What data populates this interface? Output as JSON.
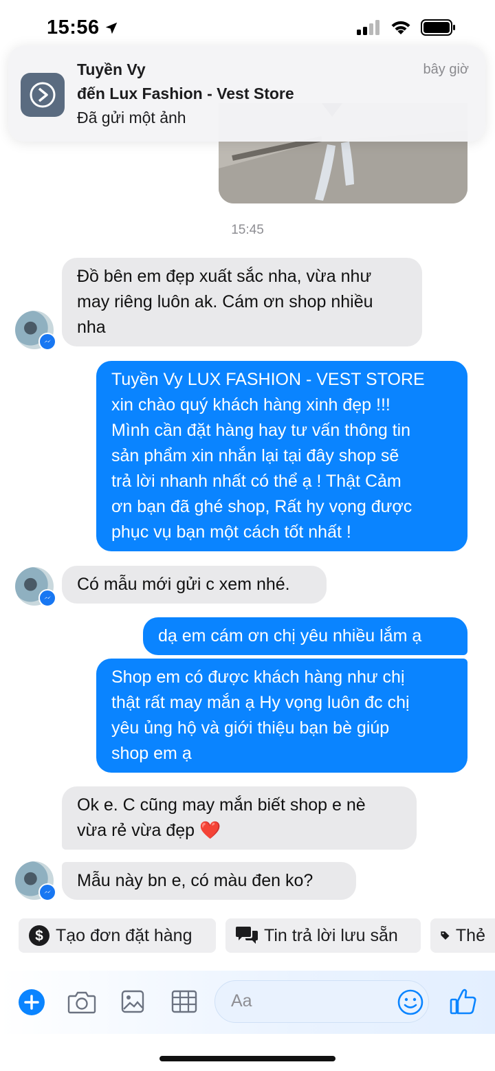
{
  "status": {
    "time": "15:56"
  },
  "notification": {
    "sender": "Tuyền Vy",
    "to": "đến Lux Fashion - Vest Store",
    "message": "Đã gửi một ảnh",
    "time": "bây giờ"
  },
  "chat": {
    "timestamp": "15:45",
    "messages": [
      {
        "from": "customer",
        "text": "Đồ bên em đẹp xuất sắc nha, vừa như\nmay riêng luôn ak. Cám ơn shop nhiều\nnha"
      },
      {
        "from": "shop",
        "text": "Tuyền Vy LUX FASHION - VEST STORE\nxin chào quý khách hàng xinh đẹp !!!\nMình cần đặt hàng hay tư vấn thông tin\nsản phẩm xin nhắn lại tại đây shop sẽ\ntrả lời nhanh nhất có thể ạ ! Thật Cảm\nơn bạn đã ghé shop, Rất hy vọng được\nphục vụ bạn một cách tốt nhất !"
      },
      {
        "from": "customer",
        "text": "Có mẫu mới gửi c xem nhé."
      },
      {
        "from": "shop",
        "text": "dạ em cám ơn chị yêu nhiều lắm ạ"
      },
      {
        "from": "shop",
        "text": "Shop em có được khách hàng như chị\nthật rất may mắn ạ Hy vọng luôn đc chị\nyêu ủng hộ và giới thiệu bạn bè giúp\nshop em ạ"
      },
      {
        "from": "customer",
        "text": "Ok e. C cũng may mắn biết shop e nè\nvừa rẻ vừa đẹp ❤️"
      },
      {
        "from": "customer",
        "text": "Mẫu này bn e, có màu đen ko?"
      }
    ]
  },
  "quick_replies": [
    {
      "label": "Tạo đơn đặt hàng",
      "icon": "dollar-icon"
    },
    {
      "label": "Tin trả lời lưu sẵn",
      "icon": "chat-bubbles-icon"
    },
    {
      "label": "Thẻ",
      "icon": "tag-icon"
    }
  ],
  "composer": {
    "placeholder": "Aa"
  },
  "colors": {
    "outgoing": "#0a84ff",
    "incoming": "#e9e9eb",
    "accent": "#1877f2"
  }
}
